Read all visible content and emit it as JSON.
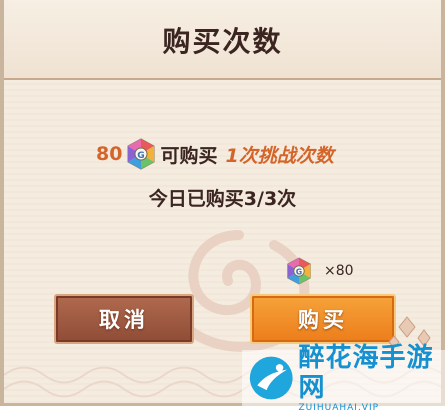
{
  "dialog": {
    "title": "购买次数"
  },
  "price": {
    "amount": "80",
    "currency_icon": "jade-gem-icon",
    "text": "可购买",
    "highlight": "1次挑战次数"
  },
  "status": {
    "today_purchased": "今日已购买3/3次"
  },
  "cost": {
    "icon": "jade-gem-icon",
    "quantity": "×80"
  },
  "buttons": {
    "cancel_label": "取消",
    "buy_label": "购买"
  },
  "watermark": {
    "name": "醉花海手游网",
    "url": "ZUIHUAHAI.VIP"
  },
  "colors": {
    "accent_orange": "#d4652a",
    "buy_button": "#ec7d1b",
    "cancel_button": "#8f4c36",
    "panel_bg": "#f5ece0",
    "text_dark": "#3a2520",
    "watermark_blue": "#1590d0"
  }
}
